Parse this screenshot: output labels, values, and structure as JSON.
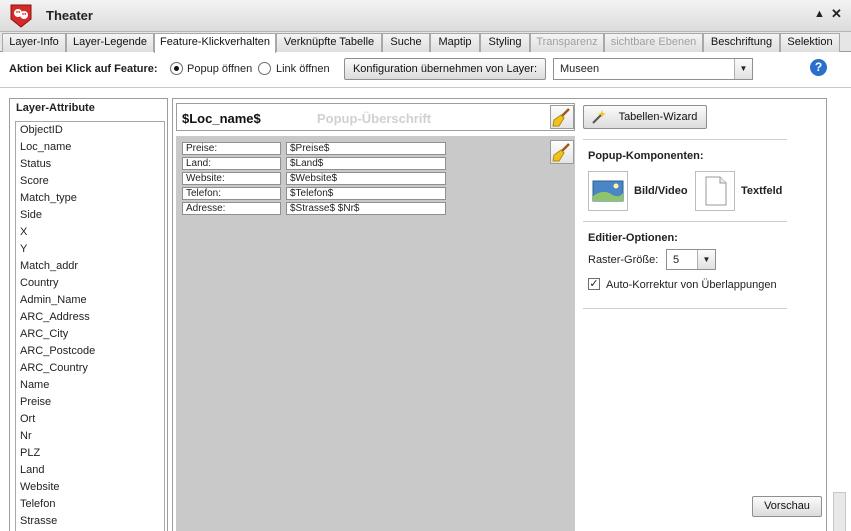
{
  "window": {
    "title": "Theater",
    "collapse_glyph": "▲",
    "close_glyph": "✕"
  },
  "tabs": [
    {
      "label": "Layer-Info",
      "state": "normal"
    },
    {
      "label": "Layer-Legende",
      "state": "normal"
    },
    {
      "label": "Feature-Klickverhalten",
      "state": "active"
    },
    {
      "label": "Verknüpfte Tabelle",
      "state": "normal"
    },
    {
      "label": "Suche",
      "state": "normal"
    },
    {
      "label": "Maptip",
      "state": "normal"
    },
    {
      "label": "Styling",
      "state": "normal"
    },
    {
      "label": "Transparenz",
      "state": "disabled"
    },
    {
      "label": "sichtbare Ebenen",
      "state": "disabled"
    },
    {
      "label": "Beschriftung",
      "state": "normal"
    },
    {
      "label": "Selektion",
      "state": "normal"
    }
  ],
  "feature_action": {
    "label": "Aktion bei Klick auf Feature:",
    "popup_option": "Popup öffnen",
    "link_option": "Link öffnen",
    "selected": "popup",
    "apply_button": "Konfiguration übernehmen von Layer:",
    "layer_select_value": "Museen",
    "help_glyph": "?"
  },
  "attributes": {
    "title": "Layer-Attribute",
    "items": [
      "ObjectID",
      "Loc_name",
      "Status",
      "Score",
      "Match_type",
      "Side",
      "X",
      "Y",
      "Match_addr",
      "Country",
      "Admin_Name",
      "ARC_Address",
      "ARC_City",
      "ARC_Postcode",
      "ARC_Country",
      "Name",
      "Preise",
      "Ort",
      "Nr",
      "PLZ",
      "Land",
      "Website",
      "Telefon",
      "Strasse"
    ]
  },
  "popup": {
    "header_value": "$Loc_name$",
    "header_placeholder": "Popup-Überschrift",
    "rows": [
      {
        "label": "Preise:",
        "value": "$Preise$"
      },
      {
        "label": "Land:",
        "value": "$Land$"
      },
      {
        "label": "Website:",
        "value": "$Website$"
      },
      {
        "label": "Telefon:",
        "value": "$Telefon$"
      },
      {
        "label": "Adresse:",
        "value": "$Strasse$ $Nr$"
      }
    ]
  },
  "options": {
    "wizard_button": "Tabellen-Wizard",
    "components_heading": "Popup-Komponenten:",
    "image_video_label": "Bild/Video",
    "textfield_label": "Textfeld",
    "edit_heading": "Editier-Optionen:",
    "grid_size_label": "Raster-Größe:",
    "grid_size_value": "5",
    "auto_correct_label": "Auto-Korrektur von Überlappungen",
    "auto_correct_checked": true,
    "preview_button": "Vorschau"
  },
  "colors": {
    "canvas_bg": "#c9c9c9",
    "brand_red": "#d42a2a",
    "help_blue": "#2a6fc9"
  }
}
